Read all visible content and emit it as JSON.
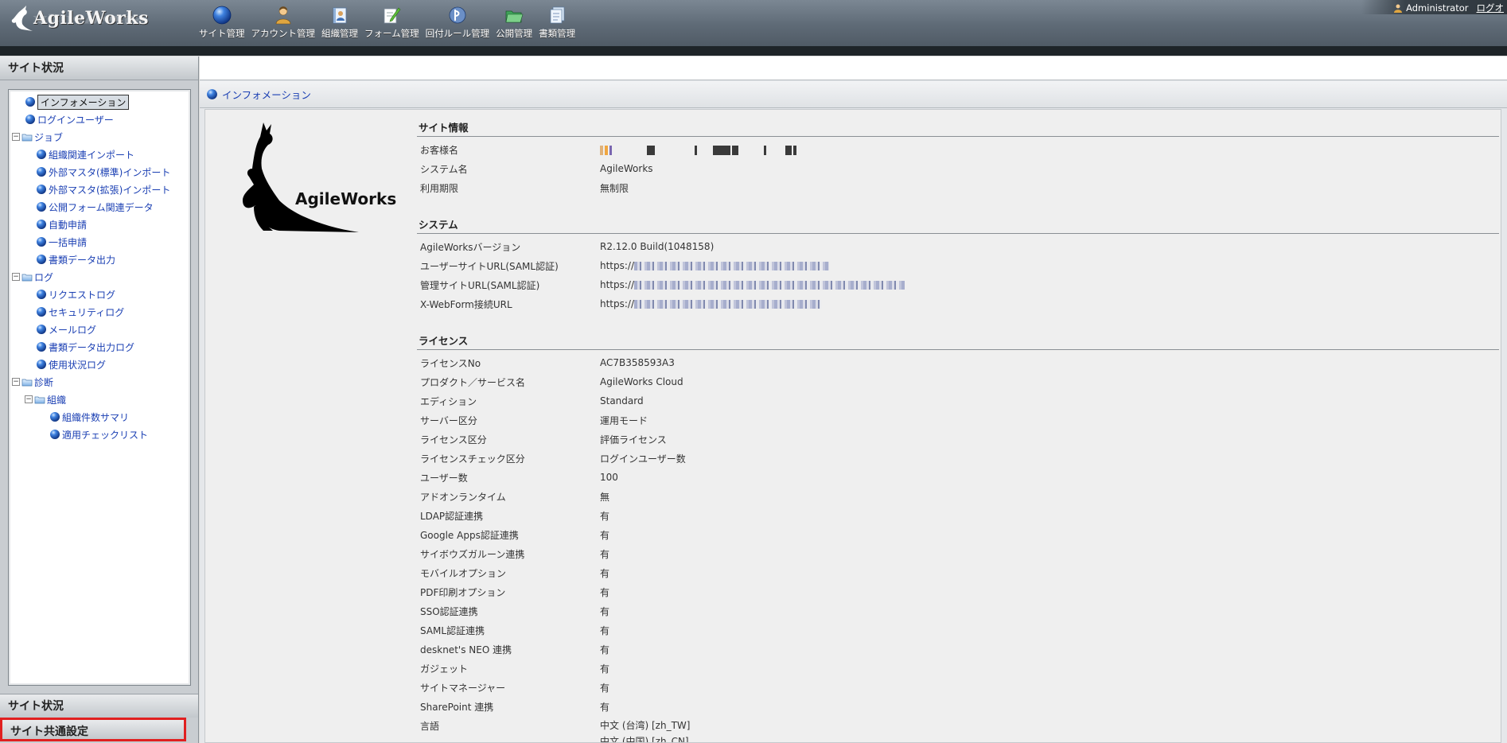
{
  "app": {
    "logo_text": "AgileWorks",
    "user_name": "Administrator",
    "logout_label": "ログオ"
  },
  "menu": [
    {
      "label": "サイト管理",
      "icon": "globe-icon"
    },
    {
      "label": "アカウント管理",
      "icon": "user-icon"
    },
    {
      "label": "組織管理",
      "icon": "org-book-icon"
    },
    {
      "label": "フォーム管理",
      "icon": "form-edit-icon"
    },
    {
      "label": "回付ルール管理",
      "icon": "route-rule-icon"
    },
    {
      "label": "公開管理",
      "icon": "folder-open-icon"
    },
    {
      "label": "書類管理",
      "icon": "documents-icon"
    }
  ],
  "sidebar": {
    "header": "サイト状況",
    "bottom_status": "サイト状況",
    "bottom_common": "サイト共通設定",
    "tree": {
      "info": "インフォメーション",
      "login_user": "ログインユーザー",
      "job": "ジョブ",
      "job_items": [
        "組織関連インポート",
        "外部マスタ(標準)インポート",
        "外部マスタ(拡張)インポート",
        "公開フォーム関連データ",
        "自動申請",
        "一括申請",
        "書類データ出力"
      ],
      "log": "ログ",
      "log_items": [
        "リクエストログ",
        "セキュリティログ",
        "メールログ",
        "書類データ出力ログ",
        "使用状況ログ"
      ],
      "diag": "診断",
      "org": "組織",
      "org_items": [
        "組織件数サマリ",
        "適用チェックリスト"
      ]
    }
  },
  "main": {
    "title": "インフォメーション",
    "kangaroo_text": "AgileWorks",
    "site_info": {
      "heading": "サイト情報",
      "rows": [
        {
          "k": "お客様名",
          "v": ""
        },
        {
          "k": "システム名",
          "v": "AgileWorks"
        },
        {
          "k": "利用期限",
          "v": "無制限"
        }
      ]
    },
    "system": {
      "heading": "システム",
      "rows": [
        {
          "k": "AgileWorksバージョン",
          "v": "R2.12.0 Build(1048158)"
        },
        {
          "k": "ユーザーサイトURL(SAML認証)",
          "v": "https://"
        },
        {
          "k": "管理サイトURL(SAML認証)",
          "v": "https://"
        },
        {
          "k": "X-WebForm接続URL",
          "v": "https://"
        }
      ]
    },
    "license": {
      "heading": "ライセンス",
      "rows": [
        {
          "k": "ライセンスNo",
          "v": "AC7B358593A3"
        },
        {
          "k": "プロダクト／サービス名",
          "v": "AgileWorks Cloud"
        },
        {
          "k": "エディション",
          "v": "Standard"
        },
        {
          "k": "サーバー区分",
          "v": "運用モード"
        },
        {
          "k": "ライセンス区分",
          "v": "評価ライセンス"
        },
        {
          "k": "ライセンスチェック区分",
          "v": "ログインユーザー数"
        },
        {
          "k": "ユーザー数",
          "v": "100"
        },
        {
          "k": "アドオンランタイム",
          "v": "無"
        },
        {
          "k": "LDAP認証連携",
          "v": "有"
        },
        {
          "k": "Google Apps認証連携",
          "v": "有"
        },
        {
          "k": "サイボウズガルーン連携",
          "v": "有"
        },
        {
          "k": "モバイルオプション",
          "v": "有"
        },
        {
          "k": "PDF印刷オプション",
          "v": "有"
        },
        {
          "k": "SSO認証連携",
          "v": "有"
        },
        {
          "k": "SAML認証連携",
          "v": "有"
        },
        {
          "k": "desknet's NEO 連携",
          "v": "有"
        },
        {
          "k": "ガジェット",
          "v": "有"
        },
        {
          "k": "サイトマネージャー",
          "v": "有"
        },
        {
          "k": "SharePoint 連携",
          "v": "有"
        },
        {
          "k": "言語",
          "v": "中文 (台湾) [zh_TW]"
        },
        {
          "k": "",
          "v": "中文 (中国) [zh_CN]"
        }
      ]
    }
  }
}
